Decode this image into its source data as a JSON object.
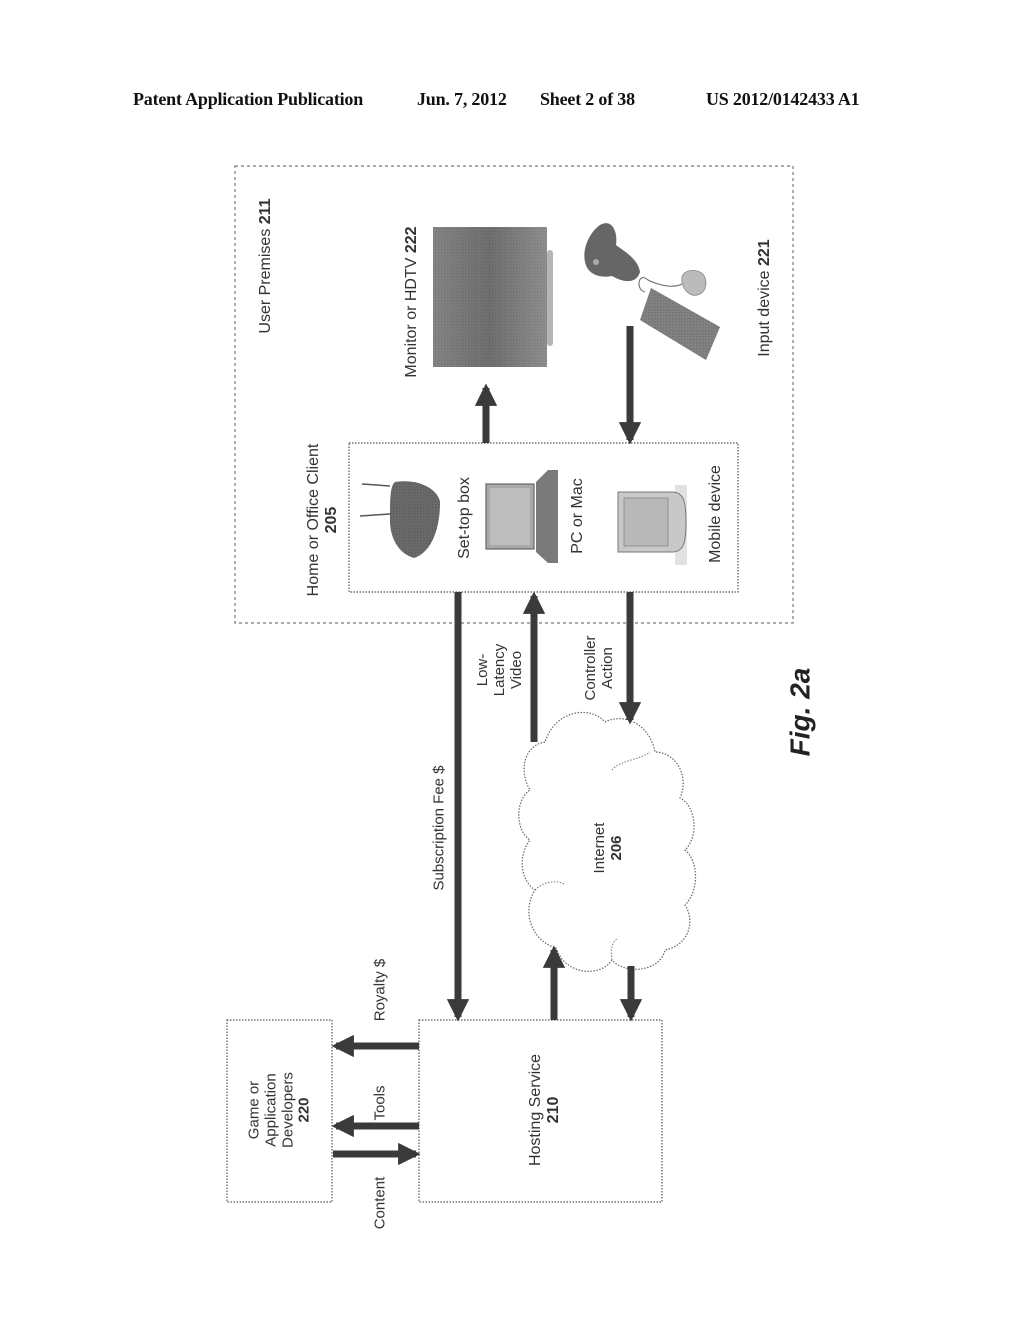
{
  "header": {
    "publication": "Patent Application Publication",
    "date": "Jun. 7, 2012",
    "sheet": "Sheet 2 of 38",
    "number": "US 2012/0142433 A1"
  },
  "figure": {
    "label": "Fig. 2a",
    "orientation": "rotated 90° counter-clockwise"
  },
  "nodes": {
    "user_premises": {
      "label": "User Premises",
      "ref": "211"
    },
    "client": {
      "label": "Home or Office Client",
      "ref": "205"
    },
    "monitor": {
      "label": "Monitor or HDTV",
      "ref": "222"
    },
    "input_device": {
      "label": "Input device",
      "ref": "221"
    },
    "internet": {
      "label": "Internet",
      "ref": "206"
    },
    "hosting": {
      "label": "Hosting Service",
      "ref": "210"
    },
    "developers": {
      "label_lines": [
        "Game or",
        "Application",
        "Developers"
      ],
      "ref": "220"
    }
  },
  "client_devices": [
    {
      "label": "Set-top box",
      "icon": "set-top-box-icon"
    },
    {
      "label": "PC or Mac",
      "icon": "laptop-icon"
    },
    {
      "label": "Mobile device",
      "icon": "mobile-device-icon"
    }
  ],
  "edges": [
    {
      "from": "client",
      "to": "monitor",
      "label": ""
    },
    {
      "from": "input_device",
      "to": "client",
      "label": ""
    },
    {
      "from": "client",
      "to": "hosting",
      "label": "Subscription Fee $"
    },
    {
      "from": "internet",
      "to": "client",
      "label_lines": [
        "Low-",
        "Latency",
        "Video"
      ]
    },
    {
      "from": "client",
      "to": "internet",
      "label_lines": [
        "Controller",
        "Action"
      ]
    },
    {
      "from": "hosting",
      "to": "internet",
      "label": ""
    },
    {
      "from": "internet",
      "to": "hosting",
      "label": ""
    },
    {
      "from": "hosting",
      "to": "developers",
      "label": "Royalty $"
    },
    {
      "from": "hosting",
      "to": "developers",
      "label": "Tools"
    },
    {
      "from": "developers",
      "to": "hosting",
      "label": "Content"
    }
  ],
  "colors": {
    "arrow": "#3a3a3a",
    "box_border": "#555555",
    "device_fill": "#6b6b6b"
  }
}
